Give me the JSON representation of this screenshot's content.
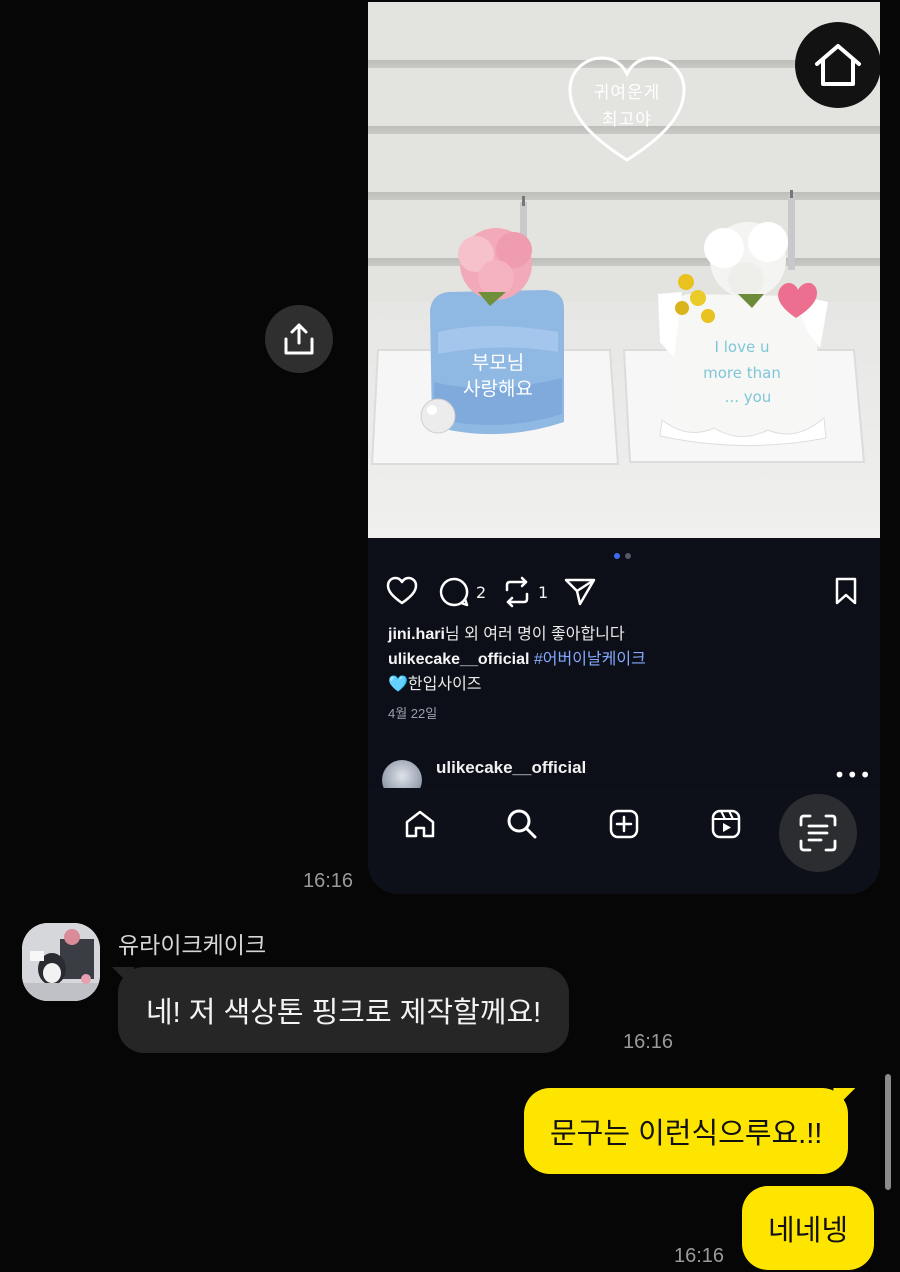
{
  "shared_post": {
    "photo_overlay_text": [
      "귀여운게",
      "최고야"
    ],
    "cake_left_text": [
      "부모님",
      "사랑해요"
    ],
    "cake_right_text": [
      "I love u",
      "more than",
      "... you"
    ],
    "carousel": {
      "total": 2,
      "active": 1
    },
    "actions": {
      "comment_count": "2",
      "repost_count": "1"
    },
    "likes": {
      "user": "jini.hari",
      "rest": "님 외 여러 명이 좋아합니다"
    },
    "caption": {
      "user": "ulikecake__official",
      "hashtag": "#어버이날케이크",
      "line2": "🩵한입사이즈"
    },
    "date": "4월 22일",
    "comment_user": "ulikecake__official",
    "icons": [
      "home-icon",
      "like-heart-icon",
      "comment-icon",
      "repost-icon",
      "send-icon",
      "bookmark-icon",
      "search-icon",
      "new-post-icon",
      "reels-icon",
      "scan-text-icon"
    ]
  },
  "chat": {
    "share_time": "16:16",
    "sender_name": "유라이크케이크",
    "messages": [
      {
        "from": "other",
        "text": "네! 저 색상톤 핑크로 제작할께요!",
        "time": "16:16"
      },
      {
        "from": "me",
        "text": "문구는 이런식으루요.!!",
        "time": ""
      },
      {
        "from": "me",
        "text": "네네넹",
        "time": "16:16"
      }
    ]
  },
  "colors": {
    "my_bubble": "#fee500",
    "other_bubble": "#262626",
    "background": "#060606",
    "link_blue": "#86a9ff"
  }
}
